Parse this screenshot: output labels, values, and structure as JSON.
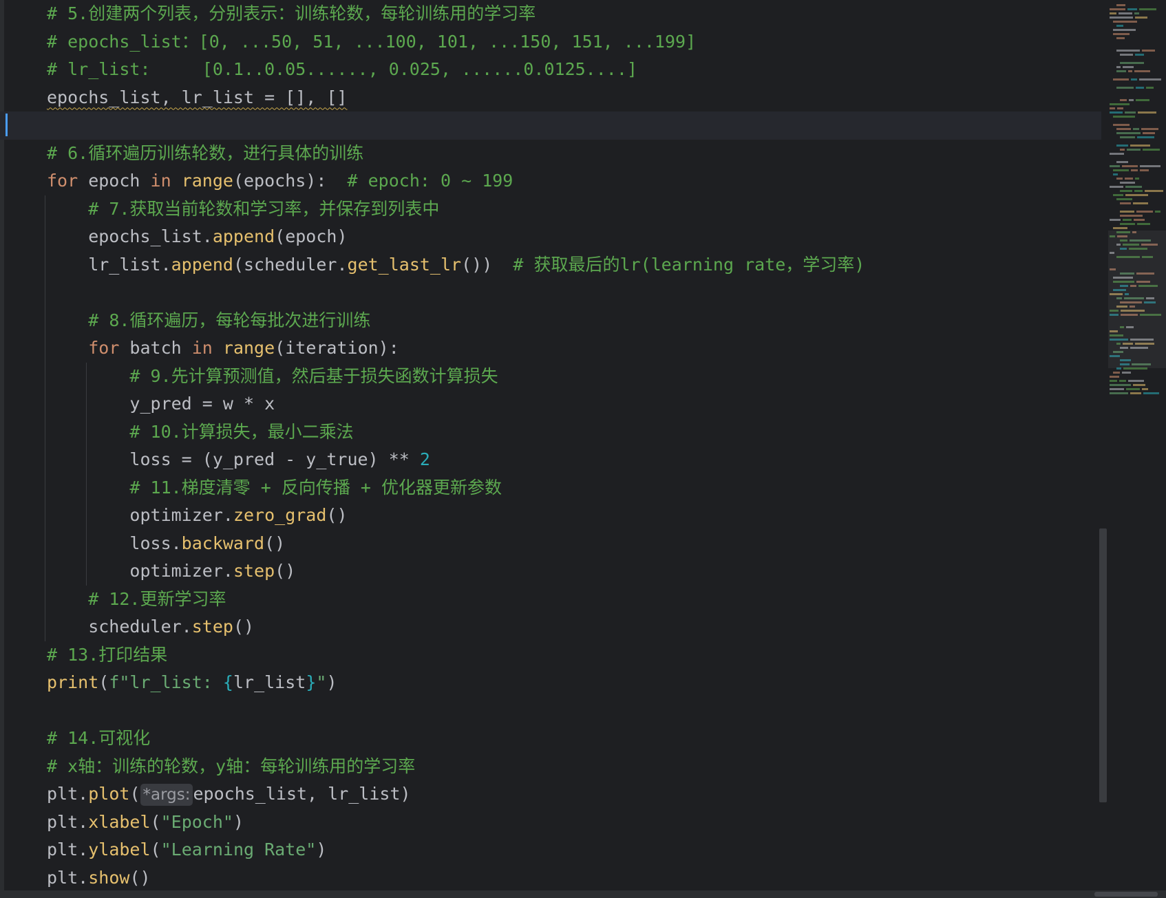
{
  "editor": {
    "lines": [
      {
        "parts": [
          {
            "t": "# 5.创建两个列表，分别表示：训练轮数，每轮训练用的学习率",
            "c": "comment"
          }
        ]
      },
      {
        "parts": [
          {
            "t": "# epochs_list：[0, ...50, 51, ...100, 101, ...150, 151, ...199]",
            "c": "comment"
          }
        ]
      },
      {
        "parts": [
          {
            "t": "# lr_list:     [0.1..0.05......, 0.025, ......0.0125....]",
            "c": "comment"
          }
        ]
      },
      {
        "parts": [
          {
            "t": "epochs_list, lr_list = [], []",
            "c": "squiggle"
          }
        ]
      },
      {
        "parts": [
          {
            "t": "",
            "c": "default"
          }
        ],
        "current": true
      },
      {
        "parts": [
          {
            "t": "# 6.循环遍历训练轮数，进行具体的训练",
            "c": "comment"
          }
        ]
      },
      {
        "parts": [
          {
            "t": "for",
            "c": "kw"
          },
          {
            "t": " epoch ",
            "c": "default"
          },
          {
            "t": "in",
            "c": "kw"
          },
          {
            "t": " ",
            "c": "default"
          },
          {
            "t": "range",
            "c": "builtin"
          },
          {
            "t": "(epochs):  ",
            "c": "default"
          },
          {
            "t": "# epoch: 0 ~ 199",
            "c": "comment"
          }
        ]
      },
      {
        "parts": [
          {
            "t": "    ",
            "c": "default"
          },
          {
            "t": "# 7.获取当前轮数和学习率，并保存到列表中",
            "c": "comment"
          }
        ]
      },
      {
        "parts": [
          {
            "t": "    epochs_list.",
            "c": "default"
          },
          {
            "t": "append",
            "c": "fn"
          },
          {
            "t": "(epoch)",
            "c": "default"
          }
        ]
      },
      {
        "parts": [
          {
            "t": "    lr_list.",
            "c": "default"
          },
          {
            "t": "append",
            "c": "fn"
          },
          {
            "t": "(scheduler.",
            "c": "default"
          },
          {
            "t": "get_last_lr",
            "c": "fn"
          },
          {
            "t": "())  ",
            "c": "default"
          },
          {
            "t": "# 获取最后的lr(learning rate，学习率)",
            "c": "comment"
          }
        ]
      },
      {
        "parts": [
          {
            "t": "",
            "c": "default"
          }
        ]
      },
      {
        "parts": [
          {
            "t": "    ",
            "c": "default"
          },
          {
            "t": "# 8.循环遍历，每轮每批次进行训练",
            "c": "comment"
          }
        ]
      },
      {
        "parts": [
          {
            "t": "    ",
            "c": "default"
          },
          {
            "t": "for",
            "c": "kw"
          },
          {
            "t": " batch ",
            "c": "default"
          },
          {
            "t": "in",
            "c": "kw"
          },
          {
            "t": " ",
            "c": "default"
          },
          {
            "t": "range",
            "c": "builtin"
          },
          {
            "t": "(iteration):",
            "c": "default"
          }
        ]
      },
      {
        "parts": [
          {
            "t": "        ",
            "c": "default"
          },
          {
            "t": "# 9.先计算预测值，然后基于损失函数计算损失",
            "c": "comment"
          }
        ]
      },
      {
        "parts": [
          {
            "t": "        y_pred = w * x",
            "c": "default"
          }
        ]
      },
      {
        "parts": [
          {
            "t": "        ",
            "c": "default"
          },
          {
            "t": "# 10.计算损失，最小二乘法",
            "c": "comment"
          }
        ]
      },
      {
        "parts": [
          {
            "t": "        loss = (y_pred - y_true) ** ",
            "c": "default"
          },
          {
            "t": "2",
            "c": "num"
          }
        ]
      },
      {
        "parts": [
          {
            "t": "        ",
            "c": "default"
          },
          {
            "t": "# 11.梯度清零 + 反向传播 + 优化器更新参数",
            "c": "comment"
          }
        ]
      },
      {
        "parts": [
          {
            "t": "        optimizer.",
            "c": "default"
          },
          {
            "t": "zero_grad",
            "c": "fn"
          },
          {
            "t": "()",
            "c": "default"
          }
        ]
      },
      {
        "parts": [
          {
            "t": "        loss.",
            "c": "default"
          },
          {
            "t": "backward",
            "c": "fn"
          },
          {
            "t": "()",
            "c": "default"
          }
        ]
      },
      {
        "parts": [
          {
            "t": "        optimizer.",
            "c": "default"
          },
          {
            "t": "step",
            "c": "fn"
          },
          {
            "t": "()",
            "c": "default"
          }
        ]
      },
      {
        "parts": [
          {
            "t": "    ",
            "c": "default"
          },
          {
            "t": "# 12.更新学习率",
            "c": "comment"
          }
        ]
      },
      {
        "parts": [
          {
            "t": "    scheduler.",
            "c": "default"
          },
          {
            "t": "step",
            "c": "fn"
          },
          {
            "t": "()",
            "c": "default"
          }
        ]
      },
      {
        "parts": [
          {
            "t": "# 13.打印结果",
            "c": "comment"
          }
        ]
      },
      {
        "parts": [
          {
            "t": "print",
            "c": "builtin"
          },
          {
            "t": "(",
            "c": "default"
          },
          {
            "t": "f\"lr_list: ",
            "c": "str"
          },
          {
            "t": "{",
            "c": "brace"
          },
          {
            "t": "lr_list",
            "c": "default"
          },
          {
            "t": "}",
            "c": "brace"
          },
          {
            "t": "\"",
            "c": "str"
          },
          {
            "t": ")",
            "c": "default"
          }
        ]
      },
      {
        "parts": [
          {
            "t": "",
            "c": "default"
          }
        ]
      },
      {
        "parts": [
          {
            "t": "# 14.可视化",
            "c": "comment"
          }
        ]
      },
      {
        "parts": [
          {
            "t": "# x轴：训练的轮数，y轴：每轮训练用的学习率",
            "c": "comment"
          }
        ]
      },
      {
        "parts": [
          {
            "t": "plt.",
            "c": "default"
          },
          {
            "t": "plot",
            "c": "fn"
          },
          {
            "t": "(",
            "c": "default"
          },
          {
            "t": "*args:",
            "c": "hint"
          },
          {
            "t": "epochs_list, lr_list)",
            "c": "default"
          }
        ]
      },
      {
        "parts": [
          {
            "t": "plt.",
            "c": "default"
          },
          {
            "t": "xlabel",
            "c": "fn"
          },
          {
            "t": "(",
            "c": "default"
          },
          {
            "t": "\"Epoch\"",
            "c": "str"
          },
          {
            "t": ")",
            "c": "default"
          }
        ]
      },
      {
        "parts": [
          {
            "t": "plt.",
            "c": "default"
          },
          {
            "t": "ylabel",
            "c": "fn"
          },
          {
            "t": "(",
            "c": "default"
          },
          {
            "t": "\"Learning Rate\"",
            "c": "str"
          },
          {
            "t": ")",
            "c": "default"
          }
        ]
      },
      {
        "parts": [
          {
            "t": "plt.",
            "c": "default"
          },
          {
            "t": "show",
            "c": "fn"
          },
          {
            "t": "()",
            "c": "default"
          }
        ]
      }
    ]
  },
  "colors": {
    "background": "#1e1f22",
    "comment": "#5ca84f",
    "keyword": "#cf8e6d",
    "function": "#e6c06e",
    "number": "#2aacb8",
    "string": "#6aab73",
    "default": "#bcbec4",
    "caret": "#4a9df8"
  }
}
